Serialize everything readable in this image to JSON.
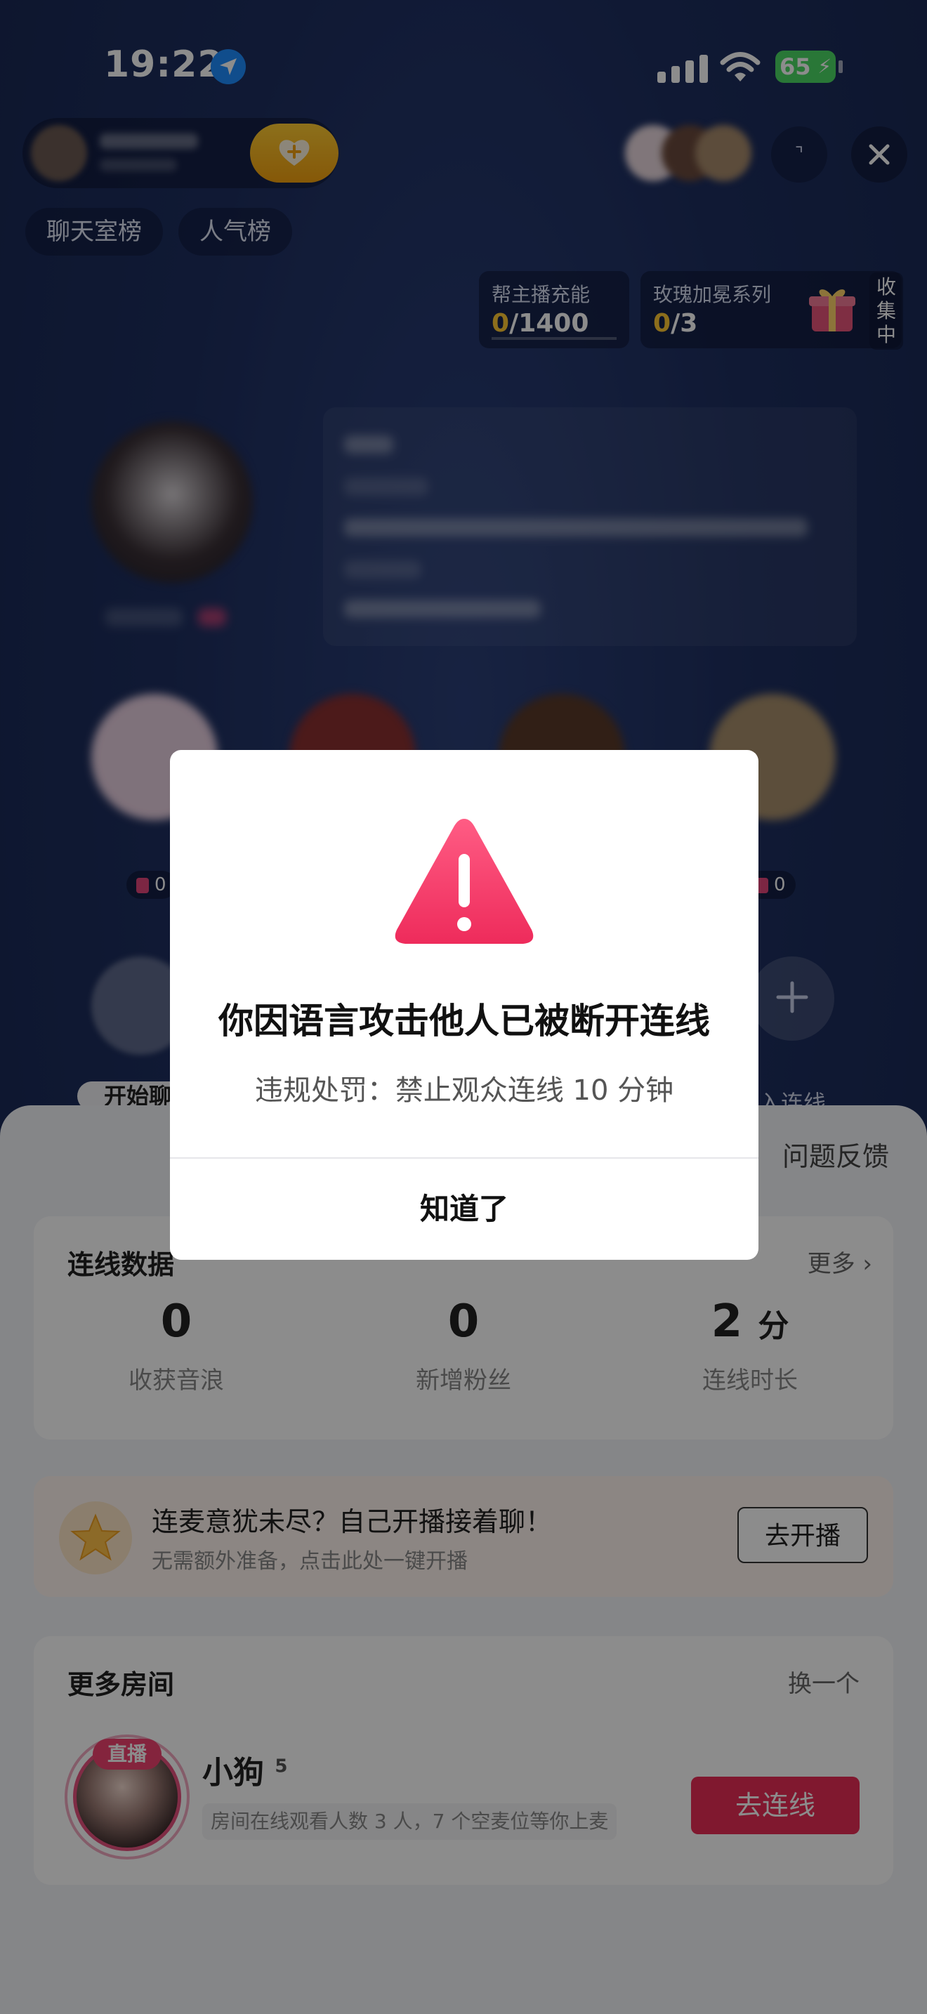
{
  "status_bar": {
    "time": "19:22",
    "battery": "65"
  },
  "top_bar": {
    "more_label": "⌝"
  },
  "rank_tabs": [
    "聊天室榜",
    "人气榜"
  ],
  "widgets": {
    "charge": {
      "title": "帮主播充能",
      "current": "0",
      "total": "/1400"
    },
    "rose": {
      "title": "玫瑰加冕系列",
      "current": "0",
      "total": "/3"
    },
    "collect_label": "收集中"
  },
  "seats": {
    "left_count": "0",
    "right_count": "0"
  },
  "room_actions": {
    "start_chat": "开始聊",
    "link": "入连线"
  },
  "sheet": {
    "feedback": "问题反馈",
    "link_stats": {
      "title": "连线数据",
      "more": "更多",
      "items": [
        {
          "value": "0",
          "unit": "",
          "label": "收获音浪"
        },
        {
          "value": "0",
          "unit": "",
          "label": "新增粉丝"
        },
        {
          "value": "2",
          "unit": "分",
          "label": "连线时长"
        }
      ]
    },
    "promo": {
      "title": "连麦意犹未尽？自己开播接着聊！",
      "subtitle": "无需额外准备，点击此处一键开播",
      "button": "去开播"
    },
    "more_rooms": {
      "title": "更多房间",
      "switch": "换一个",
      "room": {
        "live_tag": "直播",
        "name": "小狗",
        "level": "5",
        "info": "房间在线观看人数 3 人，7 个空麦位等你上麦",
        "button": "去连线"
      }
    }
  },
  "dialog": {
    "title": "你因语言攻击他人已被断开连线",
    "subtitle": "违规处罚：禁止观众连线 10 分钟",
    "confirm": "知道了"
  },
  "colors": {
    "accent": "#ea2d57",
    "warning": "#f0426f",
    "gold": "#ffc933"
  }
}
